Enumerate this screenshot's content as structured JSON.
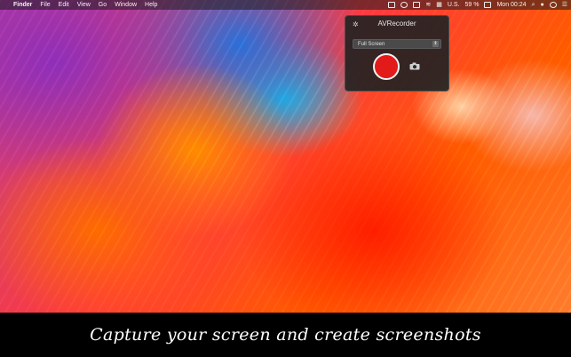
{
  "menubar": {
    "apple": "",
    "app": "Finder",
    "menus": [
      "File",
      "Edit",
      "View",
      "Go",
      "Window",
      "Help"
    ],
    "status": {
      "input_source": "U.S.",
      "battery": "59 %",
      "clock": "Mon 00:24"
    }
  },
  "panel": {
    "title": "AVRecorder",
    "capture_mode": "Full Screen"
  },
  "caption": "Capture your screen and create screenshots"
}
